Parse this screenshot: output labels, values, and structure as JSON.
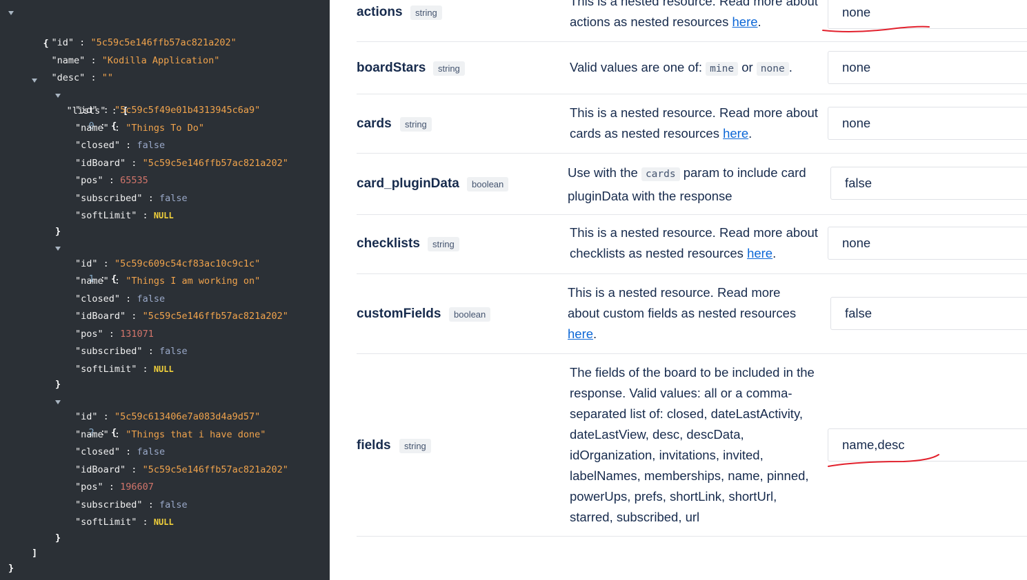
{
  "json_viewer": {
    "root_id_key": "\"id\"",
    "root_id_value": "\"5c59c5e146ffb57ac821a202\"",
    "root_name_key": "\"name\"",
    "root_name_value": "\"Kodilla Application\"",
    "root_desc_key": "\"desc\"",
    "root_desc_value": "\"\"",
    "lists_key": "\"lists\"",
    "open_brace": "{",
    "close_brace": "}",
    "open_bracket": "[",
    "close_bracket": "]",
    "colon": ":",
    "items": [
      {
        "index": "0",
        "id_key": "\"id\"",
        "id_value": "\"5c59c5f49e01b4313945c6a9\"",
        "name_key": "\"name\"",
        "name_value": "\"Things To Do\"",
        "closed_key": "\"closed\"",
        "closed_value": "false",
        "idBoard_key": "\"idBoard\"",
        "idBoard_value": "\"5c59c5e146ffb57ac821a202\"",
        "pos_key": "\"pos\"",
        "pos_value": "65535",
        "subscribed_key": "\"subscribed\"",
        "subscribed_value": "false",
        "softLimit_key": "\"softLimit\"",
        "softLimit_value": "NULL"
      },
      {
        "index": "1",
        "id_key": "\"id\"",
        "id_value": "\"5c59c609c54cf83ac10c9c1c\"",
        "name_key": "\"name\"",
        "name_value": "\"Things I am working on\"",
        "closed_key": "\"closed\"",
        "closed_value": "false",
        "idBoard_key": "\"idBoard\"",
        "idBoard_value": "\"5c59c5e146ffb57ac821a202\"",
        "pos_key": "\"pos\"",
        "pos_value": "131071",
        "subscribed_key": "\"subscribed\"",
        "subscribed_value": "false",
        "softLimit_key": "\"softLimit\"",
        "softLimit_value": "NULL"
      },
      {
        "index": "2",
        "id_key": "\"id\"",
        "id_value": "\"5c59c613406e7a083d4a9d57\"",
        "name_key": "\"name\"",
        "name_value": "\"Things that i have done\"",
        "closed_key": "\"closed\"",
        "closed_value": "false",
        "idBoard_key": "\"idBoard\"",
        "idBoard_value": "\"5c59c5e146ffb57ac821a202\"",
        "pos_key": "\"pos\"",
        "pos_value": "196607",
        "subscribed_key": "\"subscribed\"",
        "subscribed_value": "false",
        "softLimit_key": "\"softLimit\"",
        "softLimit_value": "NULL"
      }
    ]
  },
  "params": {
    "actions": {
      "name": "actions",
      "type": "string",
      "desc_line1": "This is a nested resource. Read more about",
      "desc_line2": "actions as nested resources",
      "link": "here",
      "period": ".",
      "value": "none"
    },
    "boardStars": {
      "name": "boardStars",
      "type": "string",
      "desc_pre": "Valid values are one of:",
      "code1": "mine",
      "desc_or": "or",
      "code2": "none",
      "period": ".",
      "value": "none"
    },
    "cards": {
      "name": "cards",
      "type": "string",
      "desc_line1": "This is a nested resource. Read more about",
      "desc_line2": "cards as nested resources",
      "link": "here",
      "period": ".",
      "value": "none"
    },
    "card_pluginData": {
      "name": "card_pluginData",
      "type": "boolean",
      "desc_pre": "Use with the",
      "code": "cards",
      "desc_post": "param to include card",
      "desc_line2": "pluginData with the response",
      "value": "false"
    },
    "checklists": {
      "name": "checklists",
      "type": "string",
      "desc_line1": "This is a nested resource. Read more about",
      "desc_line2": "checklists as nested resources",
      "link": "here",
      "period": ".",
      "value": "none"
    },
    "customFields": {
      "name": "customFields",
      "type": "boolean",
      "desc_line1": "This is a nested resource. Read more",
      "desc_line2": "about custom fields as nested resources",
      "link": "here",
      "period": ".",
      "value": "false"
    },
    "fields": {
      "name": "fields",
      "type": "string",
      "desc_lines": [
        "The fields of the board to be included in the",
        "response. Valid values: all or a comma-",
        "separated list of: closed, dateLastActivity,",
        "dateLastView, desc, descData,",
        "idOrganization, invitations, invited,",
        "labelNames, memberships, name, pinned,",
        "powerUps, prefs, shortLink, shortUrl,",
        "starred, subscribed, url"
      ],
      "value": "name,desc"
    }
  },
  "colors": {
    "json_bg": "#2b3036",
    "json_string": "#f0a34c",
    "json_bool": "#9aa9c9",
    "json_number": "#d2756b",
    "json_null": "#f2d13b",
    "link": "#0b66d6",
    "annotation": "#e2202c"
  }
}
